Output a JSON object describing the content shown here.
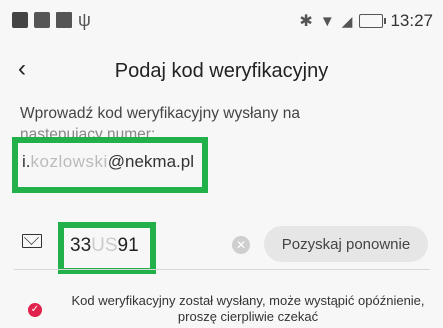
{
  "status_bar": {
    "time": "13:27",
    "left_icons": [
      "image-icon",
      "gallery-icon",
      "square-icon",
      "usb-icon"
    ],
    "right_icons": [
      "bluetooth-icon",
      "wifi-icon",
      "signal-icon",
      "battery-icon"
    ]
  },
  "header": {
    "back_glyph": "‹",
    "title": "Podaj kod weryfikacyjny"
  },
  "description": {
    "line1": "Wprowadź kod weryfikacyjny wysłany na",
    "line2": "następujący numer:"
  },
  "email": {
    "prefix": "i.",
    "masked": "kozlowski",
    "domain": "@nekma.pl"
  },
  "code_input": {
    "start": "33",
    "masked": "US",
    "end": "91"
  },
  "resend_button": {
    "label": "Pozyskaj ponownie"
  },
  "notice": {
    "text": "Kod weryfikacyjny został wysłany, może wystąpić opóźnienie, proszę cierpliwie czekać"
  },
  "colors": {
    "highlight": "#22b04b",
    "notice_icon": "#e0224c",
    "button_bg": "#e6e6e6"
  }
}
